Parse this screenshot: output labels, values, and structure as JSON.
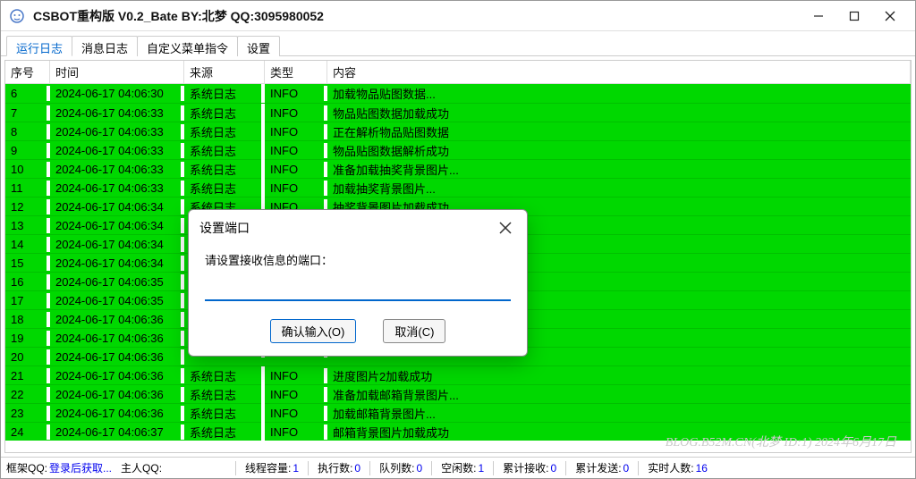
{
  "window": {
    "title": "CSBOT重构版  V0.2_Bate BY:北梦 QQ:3095980052"
  },
  "tabs": {
    "items": [
      {
        "label": "运行日志",
        "active": true
      },
      {
        "label": "消息日志",
        "active": false
      },
      {
        "label": "自定义菜单指令",
        "active": false
      },
      {
        "label": "设置",
        "active": false
      }
    ]
  },
  "columns": {
    "seq": "序号",
    "time": "时间",
    "src": "来源",
    "type": "类型",
    "msg": "内容"
  },
  "logs": [
    {
      "seq": "6",
      "time": "2024-06-17 04:06:30",
      "src": "系统日志",
      "type": "INFO",
      "msg": "加载物品贴图数据..."
    },
    {
      "seq": "7",
      "time": "2024-06-17 04:06:33",
      "src": "系统日志",
      "type": "INFO",
      "msg": "物品贴图数据加载成功"
    },
    {
      "seq": "8",
      "time": "2024-06-17 04:06:33",
      "src": "系统日志",
      "type": "INFO",
      "msg": "正在解析物品贴图数据"
    },
    {
      "seq": "9",
      "time": "2024-06-17 04:06:33",
      "src": "系统日志",
      "type": "INFO",
      "msg": "物品贴图数据解析成功"
    },
    {
      "seq": "10",
      "time": "2024-06-17 04:06:33",
      "src": "系统日志",
      "type": "INFO",
      "msg": "准备加载抽奖背景图片..."
    },
    {
      "seq": "11",
      "time": "2024-06-17 04:06:33",
      "src": "系统日志",
      "type": "INFO",
      "msg": "加载抽奖背景图片..."
    },
    {
      "seq": "12",
      "time": "2024-06-17 04:06:34",
      "src": "系统日志",
      "type": "INFO",
      "msg": "抽奖背景图片加载成功"
    },
    {
      "seq": "13",
      "time": "2024-06-17 04:06:34",
      "src": "",
      "type": "",
      "msg": ""
    },
    {
      "seq": "14",
      "time": "2024-06-17 04:06:34",
      "src": "",
      "type": "",
      "msg": ""
    },
    {
      "seq": "15",
      "time": "2024-06-17 04:06:34",
      "src": "",
      "type": "",
      "msg": ""
    },
    {
      "seq": "16",
      "time": "2024-06-17 04:06:35",
      "src": "",
      "type": "",
      "msg": ""
    },
    {
      "seq": "17",
      "time": "2024-06-17 04:06:35",
      "src": "",
      "type": "",
      "msg": ""
    },
    {
      "seq": "18",
      "time": "2024-06-17 04:06:36",
      "src": "",
      "type": "",
      "msg": ""
    },
    {
      "seq": "19",
      "time": "2024-06-17 04:06:36",
      "src": "",
      "type": "",
      "msg": ""
    },
    {
      "seq": "20",
      "time": "2024-06-17 04:06:36",
      "src": "",
      "type": "",
      "msg": ""
    },
    {
      "seq": "21",
      "time": "2024-06-17 04:06:36",
      "src": "系统日志",
      "type": "INFO",
      "msg": "进度图片2加载成功"
    },
    {
      "seq": "22",
      "time": "2024-06-17 04:06:36",
      "src": "系统日志",
      "type": "INFO",
      "msg": "准备加载邮箱背景图片..."
    },
    {
      "seq": "23",
      "time": "2024-06-17 04:06:36",
      "src": "系统日志",
      "type": "INFO",
      "msg": "加载邮箱背景图片..."
    },
    {
      "seq": "24",
      "time": "2024-06-17 04:06:37",
      "src": "系统日志",
      "type": "INFO",
      "msg": "邮箱背景图片加载成功"
    }
  ],
  "watermark": "BLOG.B52M.CN(北梦 ID:1) 2024年6月17日",
  "status": {
    "frameqq_label": "框架QQ:",
    "frameqq_value": "登录后获取...",
    "mainqq_label": "主人QQ:",
    "mainqq_value": "",
    "threadcap_label": "线程容量:",
    "threadcap_value": "1",
    "exec_label": "执行数:",
    "exec_value": "0",
    "queue_label": "队列数:",
    "queue_value": "0",
    "idle_label": "空闲数:",
    "idle_value": "1",
    "recv_label": "累计接收:",
    "recv_value": "0",
    "send_label": "累计发送:",
    "send_value": "0",
    "realtime_label": "实时人数:",
    "realtime_value": "16"
  },
  "dialog": {
    "title": "设置端口",
    "label": "请设置接收信息的端口：",
    "input_value": "",
    "ok_label": "确认输入(O)",
    "cancel_label": "取消(C)"
  }
}
